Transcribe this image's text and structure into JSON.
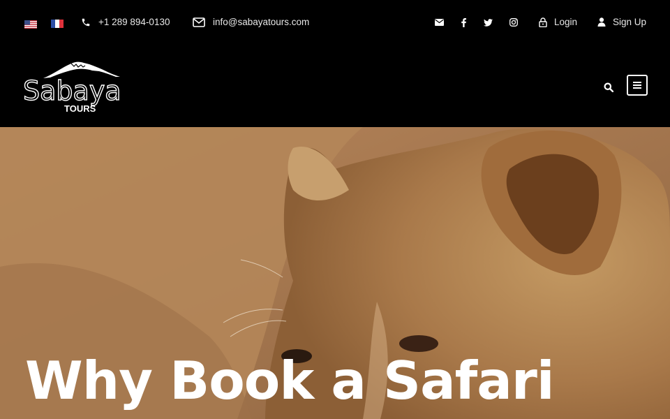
{
  "topbar": {
    "languages": [
      {
        "name": "English",
        "icon": "us-flag-icon"
      },
      {
        "name": "Français",
        "icon": "fr-flag-icon"
      }
    ],
    "phone": "+1 289 894-0130",
    "email": "info@sabayatours.com",
    "social": [
      "envelope-icon",
      "facebook-icon",
      "twitter-icon",
      "instagram-icon"
    ],
    "login_label": "Login",
    "signup_label": "Sign Up"
  },
  "header": {
    "logo_main": "Sabaya",
    "logo_sub": "TOURS"
  },
  "hero": {
    "title": "Why Book a Safari"
  },
  "colors": {
    "background": "#000000",
    "text": "#ffffff",
    "hero_tone": "#b88a55"
  }
}
